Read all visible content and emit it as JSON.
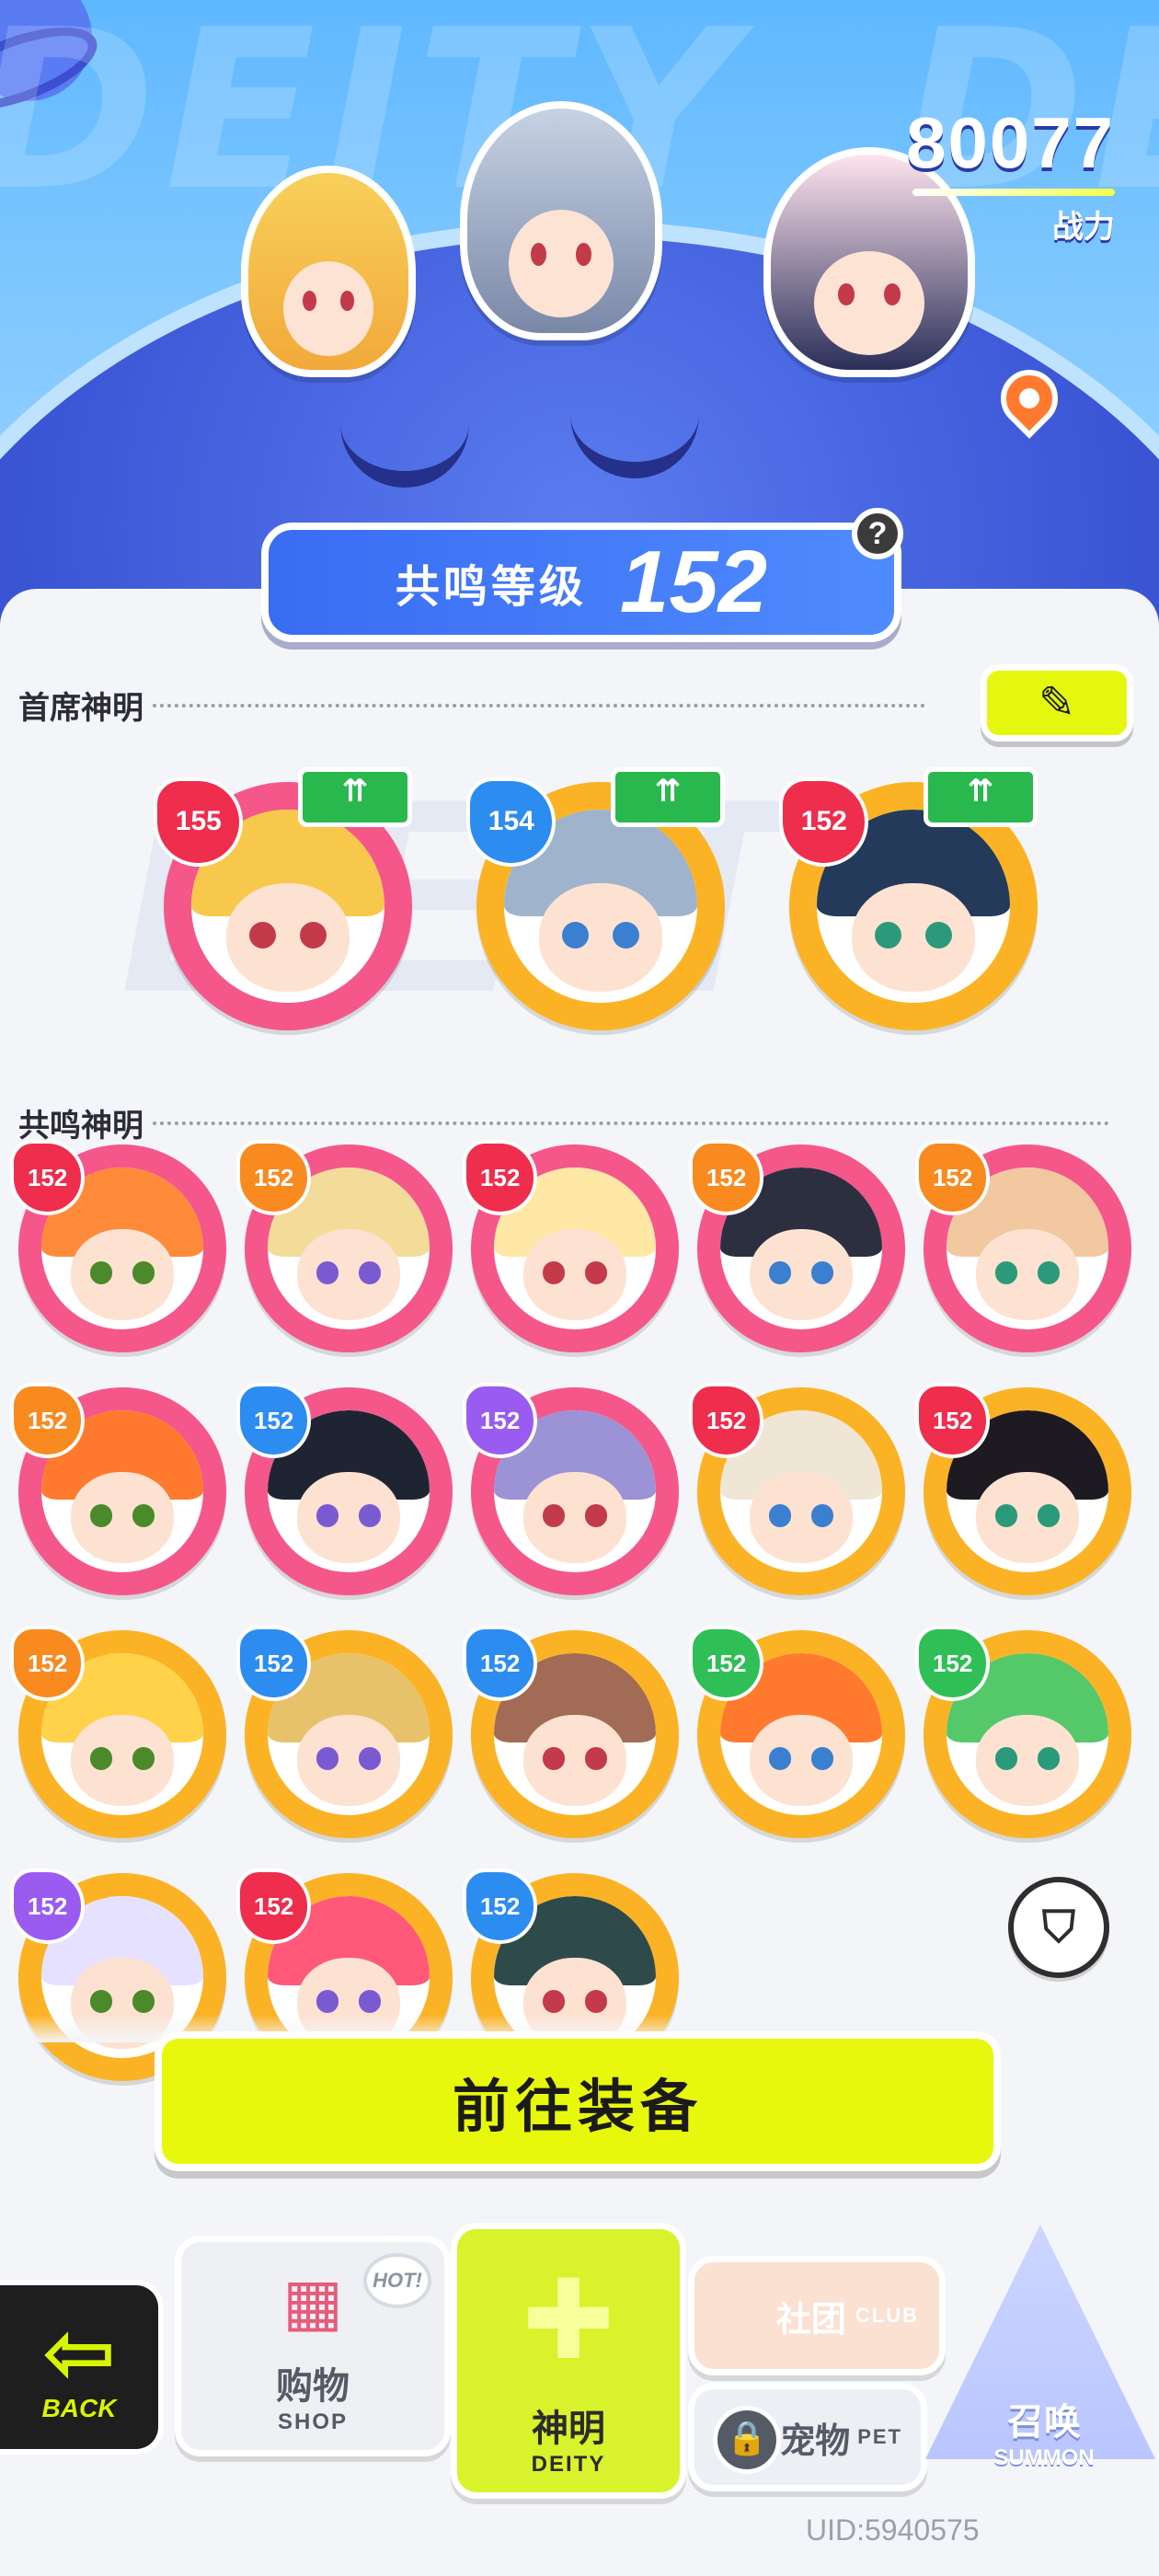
{
  "header": {
    "power_value": "80077",
    "power_label": "战力",
    "resonance_label": "共鸣等级",
    "resonance_level": "152",
    "help_icon": "?"
  },
  "lead_section": {
    "title": "首席神明",
    "edit_icon": "✎",
    "deities": [
      {
        "level": "155",
        "level_color": "red",
        "frame": "pink",
        "upgrade": "⇈"
      },
      {
        "level": "154",
        "level_color": "blue",
        "frame": "gold",
        "upgrade": "⇈"
      },
      {
        "level": "152",
        "level_color": "red",
        "frame": "gold",
        "upgrade": "⇈"
      }
    ]
  },
  "resonance_section": {
    "title": "共鸣神明",
    "deities": [
      {
        "level": "152",
        "level_color": "red",
        "frame": "pink"
      },
      {
        "level": "152",
        "level_color": "orange",
        "frame": "pink"
      },
      {
        "level": "152",
        "level_color": "red",
        "frame": "pink"
      },
      {
        "level": "152",
        "level_color": "orange",
        "frame": "pink"
      },
      {
        "level": "152",
        "level_color": "orange",
        "frame": "pink"
      },
      {
        "level": "152",
        "level_color": "orange",
        "frame": "pink"
      },
      {
        "level": "152",
        "level_color": "blue",
        "frame": "pink"
      },
      {
        "level": "152",
        "level_color": "purple",
        "frame": "pink"
      },
      {
        "level": "152",
        "level_color": "red",
        "frame": "gold"
      },
      {
        "level": "152",
        "level_color": "red",
        "frame": "gold"
      },
      {
        "level": "152",
        "level_color": "orange",
        "frame": "gold"
      },
      {
        "level": "152",
        "level_color": "blue",
        "frame": "gold"
      },
      {
        "level": "152",
        "level_color": "blue",
        "frame": "gold"
      },
      {
        "level": "152",
        "level_color": "green",
        "frame": "gold"
      },
      {
        "level": "152",
        "level_color": "green",
        "frame": "gold"
      },
      {
        "level": "152",
        "level_color": "purple",
        "frame": "gold"
      },
      {
        "level": "152",
        "level_color": "red",
        "frame": "gold"
      },
      {
        "level": "152",
        "level_color": "blue",
        "frame": "gold"
      }
    ],
    "filter_icon": "⛉"
  },
  "actions": {
    "equip_label": "前往装备"
  },
  "nav": {
    "back_label": "BACK",
    "back_icon": "⇦",
    "shop_cn": "购物",
    "shop_en": "SHOP",
    "shop_badge": "HOT!",
    "deity_cn": "神明",
    "deity_en": "DEITY",
    "club_cn": "社团",
    "club_en": "CLUB",
    "pet_cn": "宠物",
    "pet_en": "PET",
    "summon_cn": "召唤",
    "summon_en": "SUMMON"
  },
  "uid": "UID:5940575",
  "colors": {
    "accent_yellow": "#e8f80c",
    "pink_frame": "#f5578a",
    "gold_frame": "#fbb325",
    "resonance_blue": "#3a6cf2"
  }
}
